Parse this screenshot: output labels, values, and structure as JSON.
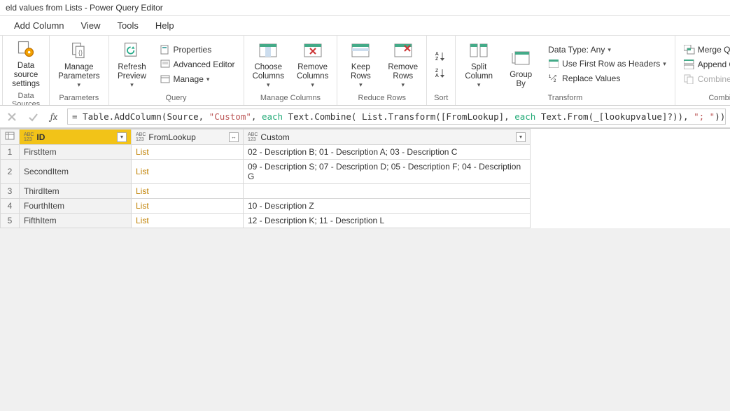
{
  "window": {
    "title": "eld values from Lists - Power Query Editor"
  },
  "menu": {
    "addColumn": "Add Column",
    "view": "View",
    "tools": "Tools",
    "help": "Help"
  },
  "ribbon": {
    "dataSources": {
      "label": "Data Sources",
      "dataSourceSettings": "Data source\nsettings"
    },
    "parameters": {
      "label": "Parameters",
      "manageParameters": "Manage\nParameters"
    },
    "query": {
      "label": "Query",
      "refreshPreview": "Refresh\nPreview",
      "properties": "Properties",
      "advancedEditor": "Advanced Editor",
      "manage": "Manage"
    },
    "manageColumns": {
      "label": "Manage Columns",
      "chooseColumns": "Choose\nColumns",
      "removeColumns": "Remove\nColumns"
    },
    "reduceRows": {
      "label": "Reduce Rows",
      "keepRows": "Keep\nRows",
      "removeRows": "Remove\nRows"
    },
    "sort": {
      "label": "Sort"
    },
    "transform": {
      "label": "Transform",
      "splitColumn": "Split\nColumn",
      "groupBy": "Group\nBy",
      "dataType": "Data Type: Any",
      "firstRowHeaders": "Use First Row as Headers",
      "replaceValues": "Replace Values"
    },
    "combine": {
      "label": "Combine",
      "mergeQueries": "Merge Queries",
      "appendQueries": "Append Queries",
      "combineFiles": "Combine Files"
    }
  },
  "formula": {
    "prefix": "= Table.AddColumn(Source, ",
    "str1": "\"Custom\"",
    "seg1": ", ",
    "kw1": "each",
    "seg2": " Text.Combine( List.Transform([FromLookup], ",
    "kw2": "each",
    "seg3": " Text.From(_[lookupvalue]?)), ",
    "str2": "\"; \"",
    "seg4": "))"
  },
  "table": {
    "columns": {
      "id": "ID",
      "fromLookup": "FromLookup",
      "custom": "Custom"
    },
    "typeLabel": {
      "abc": "ABC",
      "num": "123"
    },
    "rows": [
      {
        "n": "1",
        "id": "FirstItem",
        "from": "List",
        "custom": "02 - Description B; 01 - Description A; 03 - Description C"
      },
      {
        "n": "2",
        "id": "SecondItem",
        "from": "List",
        "custom": "09 - Description S; 07 - Description D; 05 - Description F; 04 - Description G"
      },
      {
        "n": "3",
        "id": "ThirdItem",
        "from": "List",
        "custom": ""
      },
      {
        "n": "4",
        "id": "FourthItem",
        "from": "List",
        "custom": "10 - Description Z"
      },
      {
        "n": "5",
        "id": "FifthItem",
        "from": "List",
        "custom": "12 - Description K; 11 - Description L"
      }
    ]
  }
}
